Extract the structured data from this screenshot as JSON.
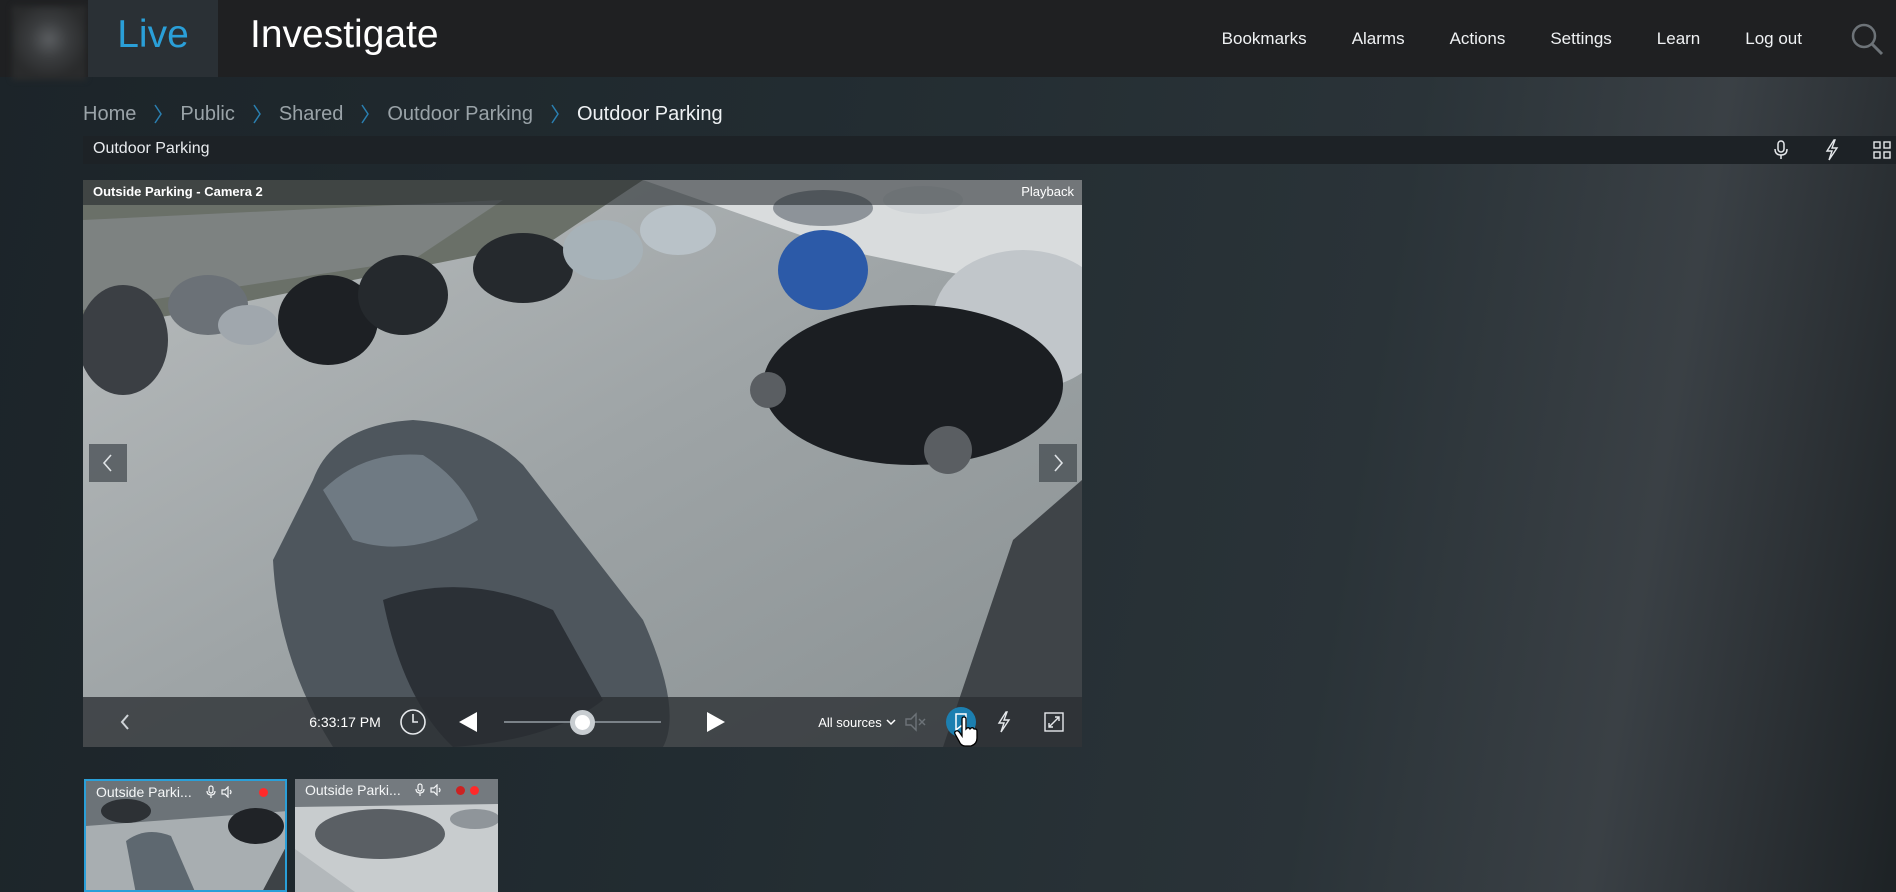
{
  "app": {
    "brand_icon": "blurred-logo",
    "tabs": [
      {
        "label": "Live",
        "active": true
      },
      {
        "label": "Investigate",
        "active": false
      }
    ],
    "nav": [
      "Bookmarks",
      "Alarms",
      "Actions",
      "Settings",
      "Learn",
      "Log out"
    ],
    "search_icon": "search-icon",
    "accent_color": "#2a9fd8"
  },
  "breadcrumb": [
    "Home",
    "Public",
    "Shared",
    "Outdoor Parking",
    "Outdoor Parking"
  ],
  "view": {
    "title": "Outdoor Parking",
    "icons": [
      "microphone-icon",
      "lightning-icon",
      "layout-grid-icon"
    ]
  },
  "camera": {
    "name": "Outside Parking - Camera 2",
    "mode": "Playback",
    "time": "6:33:17 PM",
    "sources_label": "All sources",
    "playback_position": 0.5,
    "controls": [
      "prev-icon",
      "clock-icon",
      "play-reverse-icon",
      "play-forward-icon",
      "mute-icon",
      "bookmark-icon",
      "lightning-icon",
      "fullscreen-icon"
    ]
  },
  "thumbnails": [
    {
      "label": "Outside Parki...",
      "selected": true,
      "recording": true
    },
    {
      "label": "Outside Parki...",
      "selected": false,
      "recording": true
    }
  ]
}
